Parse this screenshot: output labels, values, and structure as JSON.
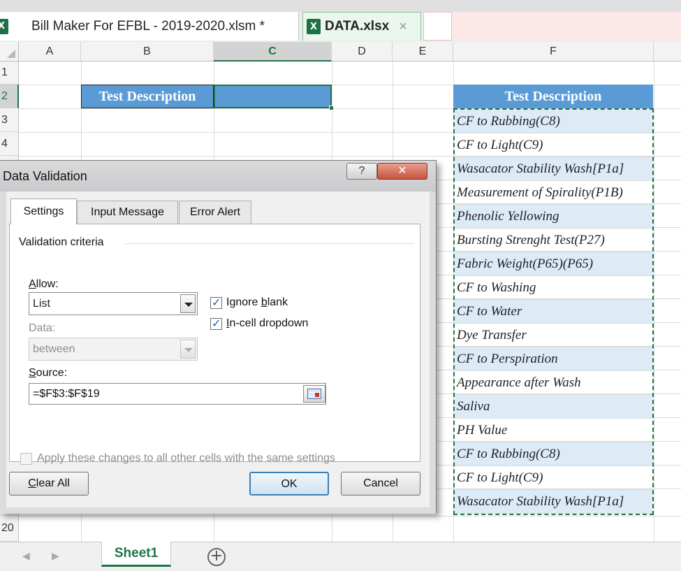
{
  "window_tabs": [
    {
      "icon": "excel-icon",
      "icon_glyph": "X",
      "title": "Bill Maker For EFBL - 2019-2020.xlsm *"
    },
    {
      "icon": "excel-icon",
      "icon_glyph": "X",
      "title": "DATA.xlsx",
      "close": "×"
    }
  ],
  "grid": {
    "columns": [
      "A",
      "B",
      "C",
      "D",
      "E",
      "F"
    ],
    "rows": [
      "1",
      "2",
      "3",
      "4",
      "20"
    ],
    "selected_column": "C",
    "selected_row": "2",
    "cells": {
      "B2": "Test Description",
      "F2": "Test Description"
    },
    "list_range": [
      "CF to Rubbing(C8)",
      "CF to Light(C9)",
      "Wasacator Stability Wash[P1a]",
      "Measurement of Spirality(P1B)",
      "Phenolic Yellowing",
      "Bursting Strenght Test(P27)",
      "Fabric Weight(P65)(P65)",
      "CF to Washing",
      "CF to Water",
      "Dye Transfer",
      "CF to Perspiration",
      "Appearance after Wash",
      "Saliva",
      "PH Value",
      "CF to Rubbing(C8)",
      "CF to Light(C9)",
      "Wasacator Stability Wash[P1a]"
    ],
    "header_fill_color": "#5b9bd5",
    "band_color": "#ddebf7",
    "selection_color": "#217346"
  },
  "sheets": {
    "tabs": [
      "Sheet1"
    ],
    "active": "Sheet1",
    "nav_prev": "◀",
    "nav_next": "▶",
    "add": "+"
  },
  "dialog": {
    "title": "Data Validation",
    "help": "?",
    "close": "✕",
    "tabs": [
      "Settings",
      "Input Message",
      "Error Alert"
    ],
    "active_tab": "Settings",
    "criteria_label": "Validation criteria",
    "allow": {
      "label_key": "A",
      "label_rest": "llow:",
      "value": "List"
    },
    "data": {
      "label": "Data:",
      "value": "between",
      "disabled": true
    },
    "ignore_blank": {
      "label_pre": "Ignore ",
      "label_key": "b",
      "label_post": "lank",
      "checked": true
    },
    "in_cell_dropdown": {
      "label_key": "I",
      "label_rest": "n-cell dropdown",
      "checked": true
    },
    "source": {
      "label_key": "S",
      "label_rest": "ource:",
      "value": "=$F$3:$F$19"
    },
    "apply_all": {
      "label": "Apply these changes to all other cells with the same settings",
      "checked": false,
      "disabled": true
    },
    "buttons": {
      "clear_key": "C",
      "clear_rest": "lear All",
      "ok": "OK",
      "cancel": "Cancel"
    }
  }
}
